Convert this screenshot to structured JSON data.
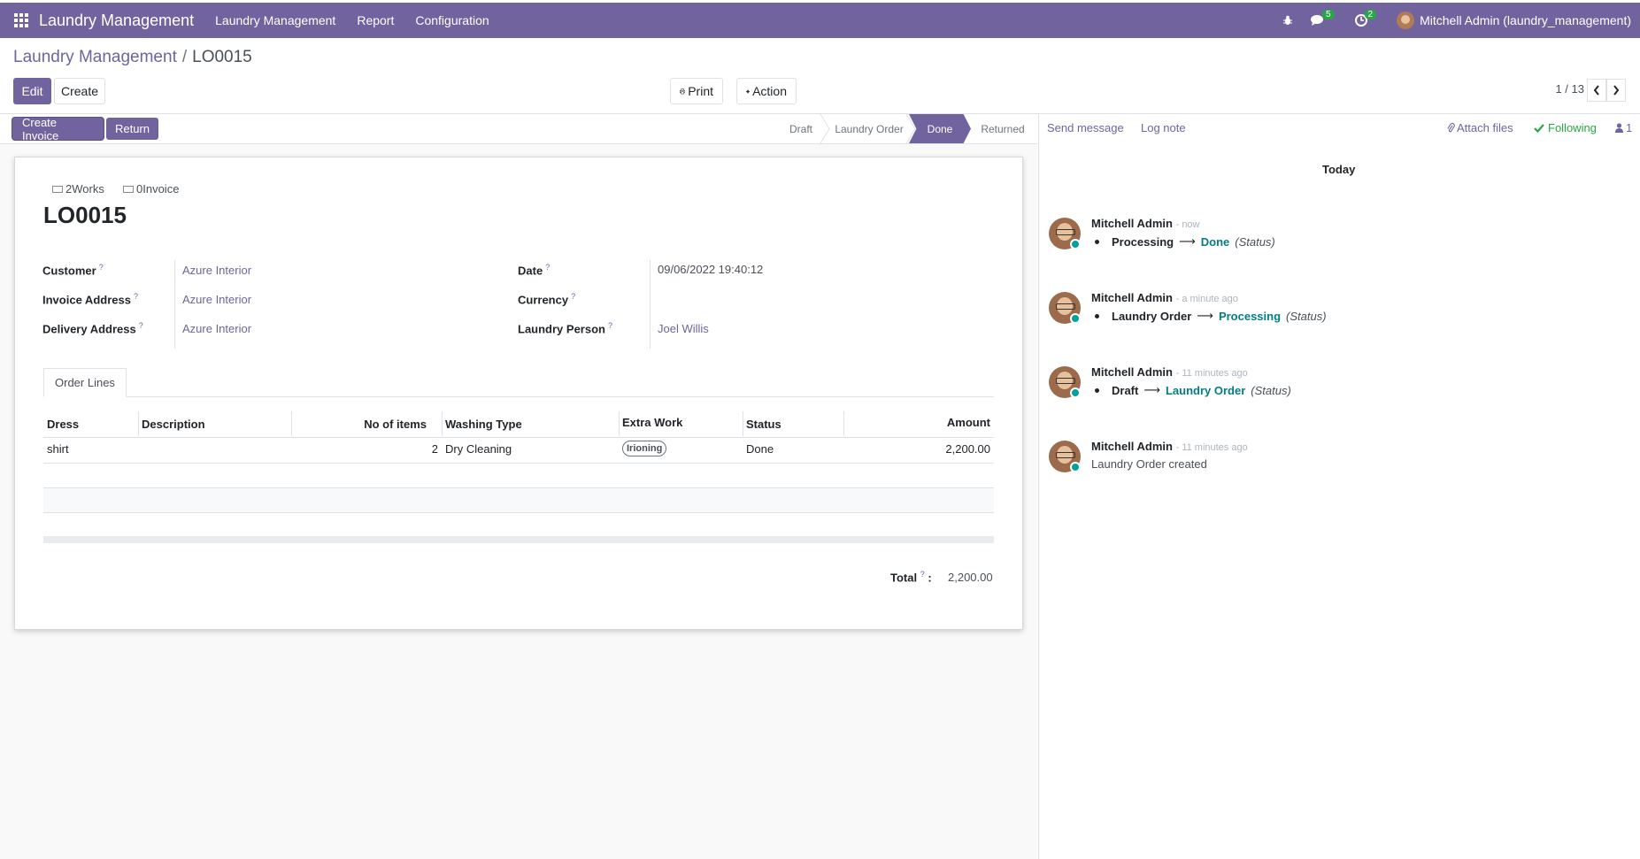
{
  "navbar": {
    "brand": "Laundry Management",
    "menus": [
      "Laundry Management",
      "Report",
      "Configuration"
    ],
    "messages_badge": "5",
    "activities_badge": "2",
    "user": "Mitchell Admin (laundry_management)"
  },
  "breadcrumb": {
    "parent": "Laundry Management",
    "current": "LO0015"
  },
  "controls": {
    "edit": "Edit",
    "create": "Create",
    "print": "Print",
    "action": "Action",
    "pager": "1 / 13"
  },
  "header_buttons": {
    "create_invoice": "Create Invoice",
    "return": "Return"
  },
  "stages": [
    "Draft",
    "Laundry Order",
    "Done",
    "Returned"
  ],
  "active_stage": "Done",
  "smart_buttons": {
    "works": "2Works",
    "invoice": "0Invoice"
  },
  "record": {
    "name": "LO0015",
    "labels": {
      "customer": "Customer",
      "invoice_address": "Invoice Address",
      "delivery_address": "Delivery Address",
      "date": "Date",
      "currency": "Currency",
      "laundry_person": "Laundry Person"
    },
    "help_mark": "?",
    "customer": "Azure Interior",
    "invoice_address": "Azure Interior",
    "delivery_address": "Azure Interior",
    "date": "09/06/2022 19:40:12",
    "currency": "",
    "laundry_person": "Joel Willis"
  },
  "tabs": {
    "order_lines": "Order Lines"
  },
  "table": {
    "headers": [
      "Dress",
      "Description",
      "No of items",
      "Washing Type",
      "Extra Work",
      "Status",
      "Amount"
    ],
    "rows": [
      {
        "dress": "shirt",
        "description": "",
        "items": "2",
        "washing_type": "Dry Cleaning",
        "extra_work": "Irioning",
        "status": "Done",
        "amount": "2,200.00"
      }
    ]
  },
  "total": {
    "label": "Total",
    "colon": ":",
    "value": "2,200.00"
  },
  "chatter": {
    "send_message": "Send message",
    "log_note": "Log note",
    "attach_files": "Attach files",
    "following": "Following",
    "followers": "1",
    "today": "Today",
    "status_field": "(Status)",
    "messages": [
      {
        "author": "Mitchell Admin",
        "time": "- now",
        "old": "Processing",
        "new": "Done"
      },
      {
        "author": "Mitchell Admin",
        "time": "- a minute ago",
        "old": "Laundry Order",
        "new": "Processing"
      },
      {
        "author": "Mitchell Admin",
        "time": "- 11 minutes ago",
        "old": "Draft",
        "new": "Laundry Order"
      },
      {
        "author": "Mitchell Admin",
        "time": "- 11 minutes ago",
        "body": "Laundry Order created"
      }
    ]
  },
  "colors": {
    "brand": "#71639e",
    "link": "#017e84",
    "following": "#28a745",
    "online": "#00a09d"
  }
}
